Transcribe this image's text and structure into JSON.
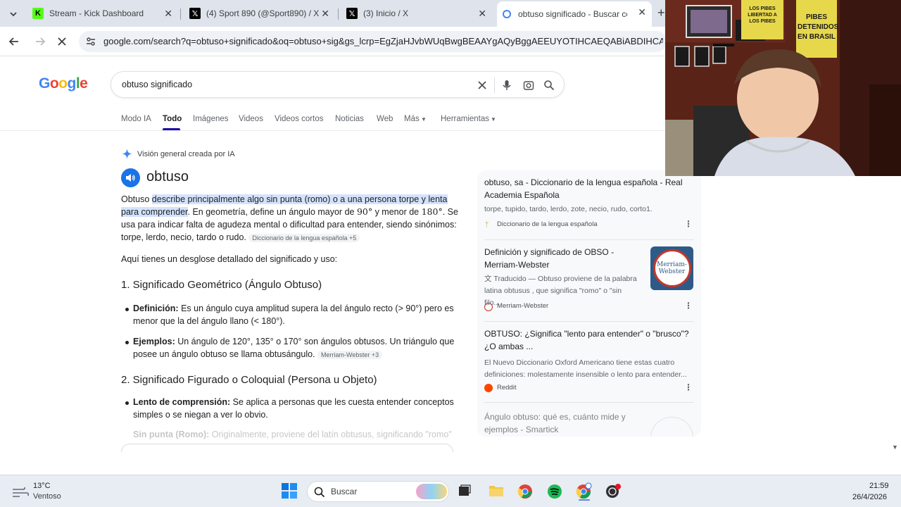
{
  "browser": {
    "tabs": [
      {
        "title": "Stream - Kick Dashboard",
        "icon": "kick-icon"
      },
      {
        "title": "(4) Sport 890 (@Sport890) / X",
        "icon": "x-icon"
      },
      {
        "title": "(3) Inicio / X",
        "icon": "x-icon"
      },
      {
        "title": "obtuso significado - Buscar con",
        "icon": "google-icon",
        "active": true
      }
    ],
    "new_tab": "+",
    "url": "google.com/search?q=obtuso+significado&oq=obtuso+sig&gs_lcrp=EgZjaHJvbWUqBwgBEAAYgAQyBggAEEUYOTIHCAEQABiABDIHCAIQ"
  },
  "google": {
    "logo": [
      "G",
      "o",
      "o",
      "g",
      "l",
      "e"
    ],
    "query": "obtuso significado",
    "tabs": [
      "Modo IA",
      "Todo",
      "Imágenes",
      "Videos",
      "Videos cortos",
      "Noticias",
      "Web",
      "Más",
      "Herramientas"
    ]
  },
  "ai_overview": {
    "label": "Visión general creada por IA",
    "word": "obtuso",
    "p1_lead": "Obtuso",
    "p1_hl": "describe principalmente algo sin punta (romo) o a una persona torpe y lenta para comprender",
    "p1_rest1": ". En geometría, define un ángulo mayor de ",
    "p1_deg90": "90°",
    "p1_rest2": " y menor de ",
    "p1_deg180": "180°",
    "p1_rest3": ". Se usa para indicar falta de agudeza mental o dificultad para entender, siendo sinónimos: torpe, lerdo, necio, tardo o rudo.",
    "p1_chip": "Diccionario de la lengua española +5",
    "intro": "Aquí tienes un desglose detallado del significado y uso:",
    "sec1": "1. Significado Geométrico (Ángulo Obtuso)",
    "b1_label": "Definición:",
    "b1_text": " Es un ángulo cuya amplitud supera la del ángulo recto (> 90°) pero es menor que la del ángulo llano (< 180°).",
    "b2_label": "Ejemplos:",
    "b2_text": " Un ángulo de 120°, 135° o 170° son ángulos obtusos. Un triángulo que posee un ángulo obtuso se llama obtusángulo.",
    "b2_chip": "Merriam-Webster +3",
    "sec2": "2. Significado Figurado o Coloquial (Persona u Objeto)",
    "b3_label": "Lento de comprensión:",
    "b3_text": " Se aplica a personas que les cuesta entender conceptos simples o se niegan a ver lo obvio.",
    "b4_label": "Sin punta (Romo):",
    "b4_text": " Originalmente, proviene del latín obtusus, significando \"romo\""
  },
  "results": [
    {
      "title": "obtuso, sa - Diccionario de la lengua española - Real Academia Española",
      "snippet": "torpe, tupido, tardo, lerdo, zote, necio, rudo, corto1.",
      "source": "Diccionario de la lengua española"
    },
    {
      "title": "Definición y significado de OBSO - Merriam-Webster",
      "snippet": "Traducido — Obtuso proviene de la palabra latina obtusus , que significa \"romo\" o \"sin filo...",
      "source": "Merriam-Webster",
      "thumb": "Merriam-Webster"
    },
    {
      "title": "OBTUSO: ¿Significa \"lento para entender\" o \"brusco\"? ¿O ambas ...",
      "snippet": "El Nuevo Diccionario Oxford Americano tiene estas cuatro definiciones: molestamente insensible o lento para entender...",
      "source": "Reddit"
    },
    {
      "title": "Ángulo obtuso: qué es, cuánto mide y ejemplos - Smartick",
      "snippet": "",
      "source": ""
    }
  ],
  "webcam": {
    "poster1": "LOS PIBES LIBERTAD A LOS PIBES",
    "poster2": "PIBES DETENIDOS EN BRASIL"
  },
  "taskbar": {
    "temp": "13°C",
    "weather": "Ventoso",
    "search_placeholder": "Buscar",
    "time": "21:59",
    "date": "26/4/2026"
  }
}
